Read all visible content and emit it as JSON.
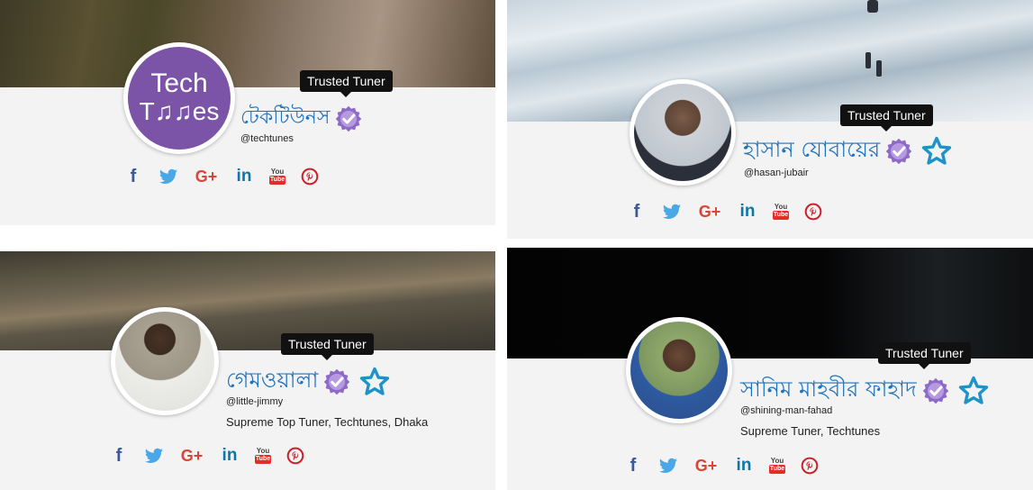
{
  "tooltip_text": "Trusted Tuner",
  "cards": [
    {
      "name": "টেকটিউনস",
      "username": "@techtunes",
      "avatar_text_top": "Tech",
      "avatar_text_bottom": "T♫♫es",
      "bio": "",
      "has_star": false
    },
    {
      "name": "হাসান যোবায়ের",
      "username": "@hasan-jubair",
      "bio": "",
      "has_star": true
    },
    {
      "name": "গেমওয়ালা",
      "username": "@little-jimmy",
      "bio": "Supreme Top Tuner, Techtunes, Dhaka",
      "has_star": true
    },
    {
      "name": "সানিম মাহবীর ফাহাদ",
      "username": "@shining-man-fahad",
      "bio": "Supreme Tuner, Techtunes",
      "has_star": true
    }
  ],
  "social": {
    "facebook": "f",
    "google_plus": "G+",
    "linkedin": "in",
    "youtube_top": "You",
    "youtube_bottom": "Tube"
  },
  "colors": {
    "name": "#1e73be",
    "badge": "#8e6ac8",
    "star": "#1e93c8",
    "facebook": "#3b5998",
    "twitter": "#4aa8e6",
    "google_plus": "#db4437",
    "linkedin": "#0e76a8",
    "youtube": "#e52d27",
    "pinterest": "#cb2027"
  }
}
